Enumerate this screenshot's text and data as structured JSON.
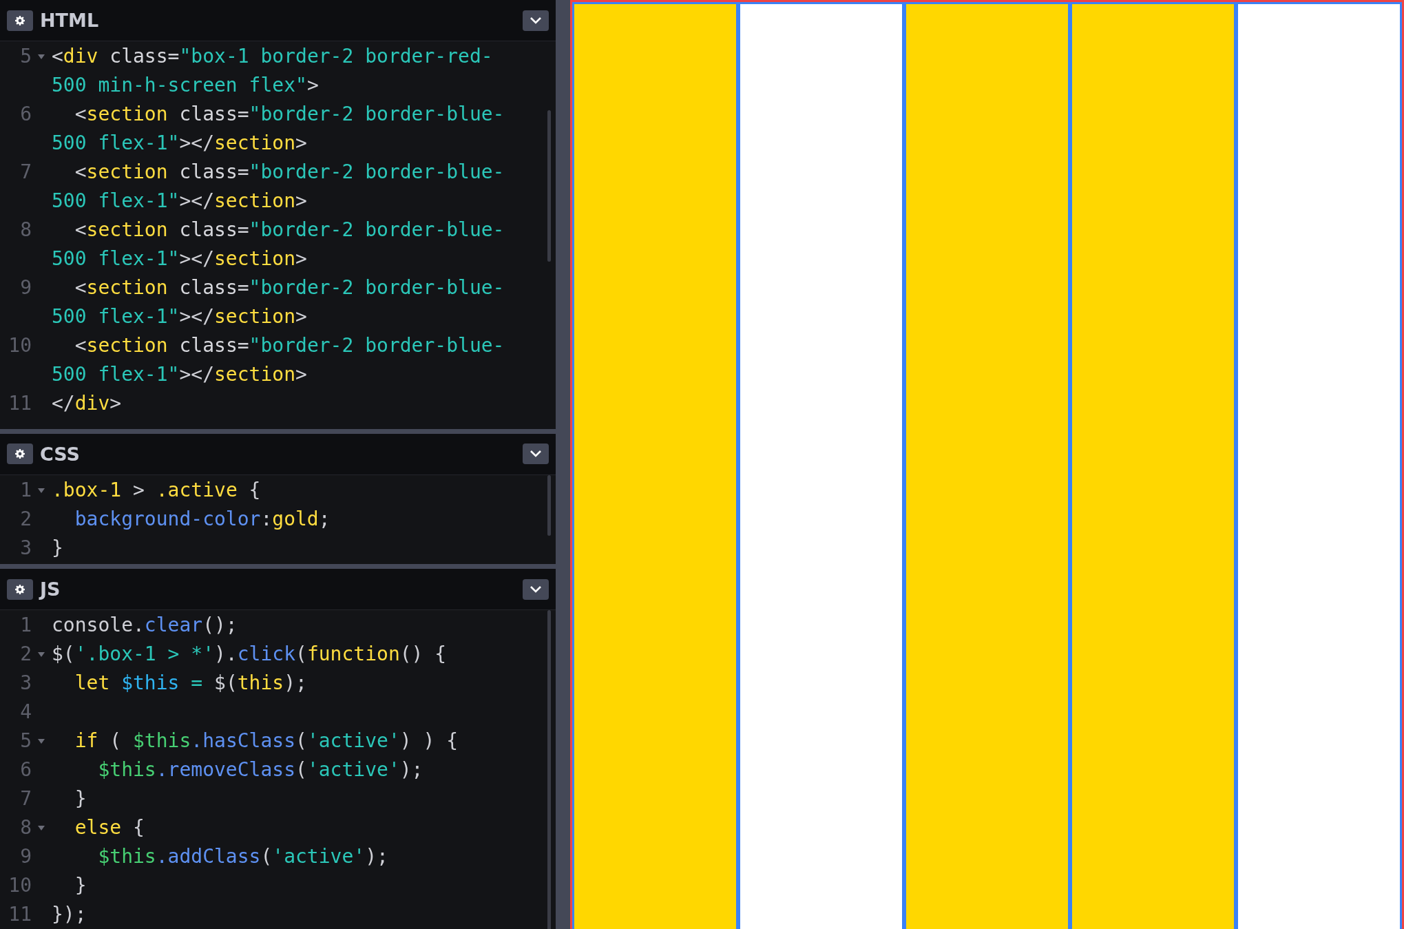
{
  "editors": [
    {
      "title": "HTML",
      "lines": [
        {
          "number": "5",
          "fold": true,
          "rows": [
            {
              "tokens": [
                {
                  "text": "<",
                  "kind": "punct"
                },
                {
                  "text": "div",
                  "kind": "tag"
                },
                {
                  "text": " class",
                  "kind": "attr"
                },
                {
                  "text": "=",
                  "kind": "punct"
                },
                {
                  "text": "\"box-1 border-2 border-red-",
                  "kind": "string"
                }
              ]
            },
            {
              "tokens": [
                {
                  "text": "500 min-h-screen flex\"",
                  "kind": "string"
                },
                {
                  "text": ">",
                  "kind": "punct"
                }
              ]
            }
          ]
        },
        {
          "number": "6",
          "fold": false,
          "rows": [
            {
              "tokens": [
                {
                  "text": "  <",
                  "kind": "punct"
                },
                {
                  "text": "section",
                  "kind": "tag"
                },
                {
                  "text": " class",
                  "kind": "attr"
                },
                {
                  "text": "=",
                  "kind": "punct"
                },
                {
                  "text": "\"border-2 border-blue-",
                  "kind": "string"
                }
              ]
            },
            {
              "tokens": [
                {
                  "text": "500 flex-1\"",
                  "kind": "string"
                },
                {
                  "text": "></",
                  "kind": "punct"
                },
                {
                  "text": "section",
                  "kind": "tag"
                },
                {
                  "text": ">",
                  "kind": "punct"
                }
              ]
            }
          ]
        },
        {
          "number": "7",
          "fold": false,
          "rows": [
            {
              "tokens": [
                {
                  "text": "  <",
                  "kind": "punct"
                },
                {
                  "text": "section",
                  "kind": "tag"
                },
                {
                  "text": " class",
                  "kind": "attr"
                },
                {
                  "text": "=",
                  "kind": "punct"
                },
                {
                  "text": "\"border-2 border-blue-",
                  "kind": "string"
                }
              ]
            },
            {
              "tokens": [
                {
                  "text": "500 flex-1\"",
                  "kind": "string"
                },
                {
                  "text": "></",
                  "kind": "punct"
                },
                {
                  "text": "section",
                  "kind": "tag"
                },
                {
                  "text": ">",
                  "kind": "punct"
                }
              ]
            }
          ]
        },
        {
          "number": "8",
          "fold": false,
          "rows": [
            {
              "tokens": [
                {
                  "text": "  <",
                  "kind": "punct"
                },
                {
                  "text": "section",
                  "kind": "tag"
                },
                {
                  "text": " class",
                  "kind": "attr"
                },
                {
                  "text": "=",
                  "kind": "punct"
                },
                {
                  "text": "\"border-2 border-blue-",
                  "kind": "string"
                }
              ]
            },
            {
              "tokens": [
                {
                  "text": "500 flex-1\"",
                  "kind": "string"
                },
                {
                  "text": "></",
                  "kind": "punct"
                },
                {
                  "text": "section",
                  "kind": "tag"
                },
                {
                  "text": ">",
                  "kind": "punct"
                }
              ]
            }
          ]
        },
        {
          "number": "9",
          "fold": false,
          "rows": [
            {
              "tokens": [
                {
                  "text": "  <",
                  "kind": "punct"
                },
                {
                  "text": "section",
                  "kind": "tag"
                },
                {
                  "text": " class",
                  "kind": "attr"
                },
                {
                  "text": "=",
                  "kind": "punct"
                },
                {
                  "text": "\"border-2 border-blue-",
                  "kind": "string"
                }
              ]
            },
            {
              "tokens": [
                {
                  "text": "500 flex-1\"",
                  "kind": "string"
                },
                {
                  "text": "></",
                  "kind": "punct"
                },
                {
                  "text": "section",
                  "kind": "tag"
                },
                {
                  "text": ">",
                  "kind": "punct"
                }
              ]
            }
          ]
        },
        {
          "number": "10",
          "fold": false,
          "rows": [
            {
              "tokens": [
                {
                  "text": "  <",
                  "kind": "punct"
                },
                {
                  "text": "section",
                  "kind": "tag"
                },
                {
                  "text": " class",
                  "kind": "attr"
                },
                {
                  "text": "=",
                  "kind": "punct"
                },
                {
                  "text": "\"border-2 border-blue-",
                  "kind": "string"
                }
              ]
            },
            {
              "tokens": [
                {
                  "text": "500 flex-1\"",
                  "kind": "string"
                },
                {
                  "text": "></",
                  "kind": "punct"
                },
                {
                  "text": "section",
                  "kind": "tag"
                },
                {
                  "text": ">",
                  "kind": "punct"
                }
              ]
            }
          ]
        },
        {
          "number": "11",
          "fold": false,
          "rows": [
            {
              "tokens": [
                {
                  "text": "</",
                  "kind": "punct"
                },
                {
                  "text": "div",
                  "kind": "tag"
                },
                {
                  "text": ">",
                  "kind": "punct"
                }
              ]
            }
          ]
        }
      ]
    },
    {
      "title": "CSS",
      "lines": [
        {
          "number": "1",
          "fold": true,
          "rows": [
            {
              "tokens": [
                {
                  "text": ".box-1",
                  "kind": "tag"
                },
                {
                  "text": " > ",
                  "kind": "punct"
                },
                {
                  "text": ".active",
                  "kind": "tag"
                },
                {
                  "text": " {",
                  "kind": "punct"
                }
              ]
            }
          ]
        },
        {
          "number": "2",
          "fold": false,
          "rows": [
            {
              "tokens": [
                {
                  "text": "  background-color",
                  "kind": "method"
                },
                {
                  "text": ":",
                  "kind": "punct"
                },
                {
                  "text": "gold",
                  "kind": "tag"
                },
                {
                  "text": ";",
                  "kind": "punct"
                }
              ]
            }
          ]
        },
        {
          "number": "3",
          "fold": false,
          "rows": [
            {
              "tokens": [
                {
                  "text": "}",
                  "kind": "punct"
                }
              ]
            }
          ]
        }
      ]
    },
    {
      "title": "JS",
      "lines": [
        {
          "number": "1",
          "fold": false,
          "rows": [
            {
              "tokens": [
                {
                  "text": "console.",
                  "kind": "punct"
                },
                {
                  "text": "clear",
                  "kind": "method"
                },
                {
                  "text": "();",
                  "kind": "punct"
                }
              ]
            }
          ]
        },
        {
          "number": "2",
          "fold": true,
          "rows": [
            {
              "tokens": [
                {
                  "text": "$(",
                  "kind": "punct"
                },
                {
                  "text": "'.box-1 > *'",
                  "kind": "string"
                },
                {
                  "text": ").",
                  "kind": "punct"
                },
                {
                  "text": "click",
                  "kind": "method"
                },
                {
                  "text": "(",
                  "kind": "punct"
                },
                {
                  "text": "function",
                  "kind": "tag"
                },
                {
                  "text": "() {",
                  "kind": "punct"
                }
              ]
            }
          ]
        },
        {
          "number": "3",
          "fold": false,
          "rows": [
            {
              "tokens": [
                {
                  "text": "  let",
                  "kind": "tag"
                },
                {
                  "text": " $this",
                  "kind": "variable"
                },
                {
                  "text": " = ",
                  "kind": "string"
                },
                {
                  "text": "$(",
                  "kind": "punct"
                },
                {
                  "text": "this",
                  "kind": "tag"
                },
                {
                  "text": ");",
                  "kind": "punct"
                }
              ]
            }
          ]
        },
        {
          "number": "4",
          "fold": false
        },
        {
          "number": "5",
          "fold": true,
          "rows": [
            {
              "tokens": [
                {
                  "text": "  if",
                  "kind": "tag"
                },
                {
                  "text": " ( ",
                  "kind": "punct"
                },
                {
                  "text": "$this",
                  "kind": "local"
                },
                {
                  "text": ".hasClass",
                  "kind": "method"
                },
                {
                  "text": "(",
                  "kind": "punct"
                },
                {
                  "text": "'active'",
                  "kind": "string"
                },
                {
                  "text": ") ) {",
                  "kind": "punct"
                }
              ]
            }
          ]
        },
        {
          "number": "6",
          "fold": false,
          "rows": [
            {
              "tokens": [
                {
                  "text": "    $this",
                  "kind": "local"
                },
                {
                  "text": ".removeClass",
                  "kind": "method"
                },
                {
                  "text": "(",
                  "kind": "punct"
                },
                {
                  "text": "'active'",
                  "kind": "string"
                },
                {
                  "text": ");",
                  "kind": "punct"
                }
              ]
            }
          ]
        },
        {
          "number": "7",
          "fold": false,
          "rows": [
            {
              "tokens": [
                {
                  "text": "  }",
                  "kind": "punct"
                }
              ]
            }
          ]
        },
        {
          "number": "8",
          "fold": true,
          "rows": [
            {
              "tokens": [
                {
                  "text": "  else",
                  "kind": "tag"
                },
                {
                  "text": " {",
                  "kind": "punct"
                }
              ]
            }
          ]
        },
        {
          "number": "9",
          "fold": false,
          "rows": [
            {
              "tokens": [
                {
                  "text": "    $this",
                  "kind": "local"
                },
                {
                  "text": ".addClass",
                  "kind": "method"
                },
                {
                  "text": "(",
                  "kind": "punct"
                },
                {
                  "text": "'active'",
                  "kind": "string"
                },
                {
                  "text": ");",
                  "kind": "punct"
                }
              ]
            }
          ]
        },
        {
          "number": "10",
          "fold": false,
          "rows": [
            {
              "tokens": [
                {
                  "text": "  }",
                  "kind": "punct"
                }
              ]
            }
          ]
        },
        {
          "number": "11",
          "fold": false,
          "rows": [
            {
              "tokens": [
                {
                  "text": "});",
                  "kind": "punct"
                }
              ]
            }
          ]
        }
      ]
    }
  ],
  "preview": {
    "sections": [
      {
        "selected": true
      },
      {
        "selected": false
      },
      {
        "selected": true
      },
      {
        "selected": true
      },
      {
        "selected": false
      }
    ]
  }
}
